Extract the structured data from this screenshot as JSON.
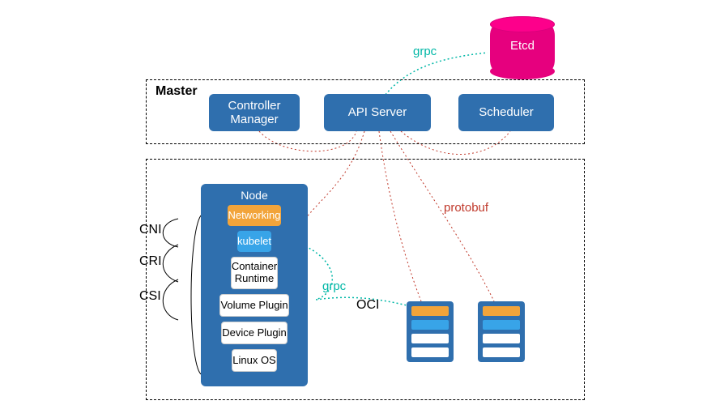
{
  "etcd": {
    "label": "Etcd"
  },
  "master": {
    "title": "Master",
    "controller_manager": "Controller\nManager",
    "api_server": "API Server",
    "scheduler": "Scheduler"
  },
  "node": {
    "title": "Node",
    "rows": {
      "networking": "Networking",
      "kubelet": "kubelet",
      "container_runtime": "Container\nRuntime",
      "volume_plugin": "Volume Plugin",
      "device_plugin": "Device Plugin",
      "linux_os": "Linux OS"
    }
  },
  "interfaces": {
    "cni": "CNI",
    "cri": "CRI",
    "csi": "CSI",
    "oci": "OCI"
  },
  "protocols": {
    "grpc_top": "grpc",
    "grpc_mid": "grpc",
    "protobuf": "protobuf"
  },
  "colors": {
    "blue": "#2f6fae",
    "gold": "#f2a43a",
    "sky": "#38a4e8",
    "etcd": "#e6007e",
    "grpc": "#00b7a6",
    "proto": "#c0392b"
  }
}
